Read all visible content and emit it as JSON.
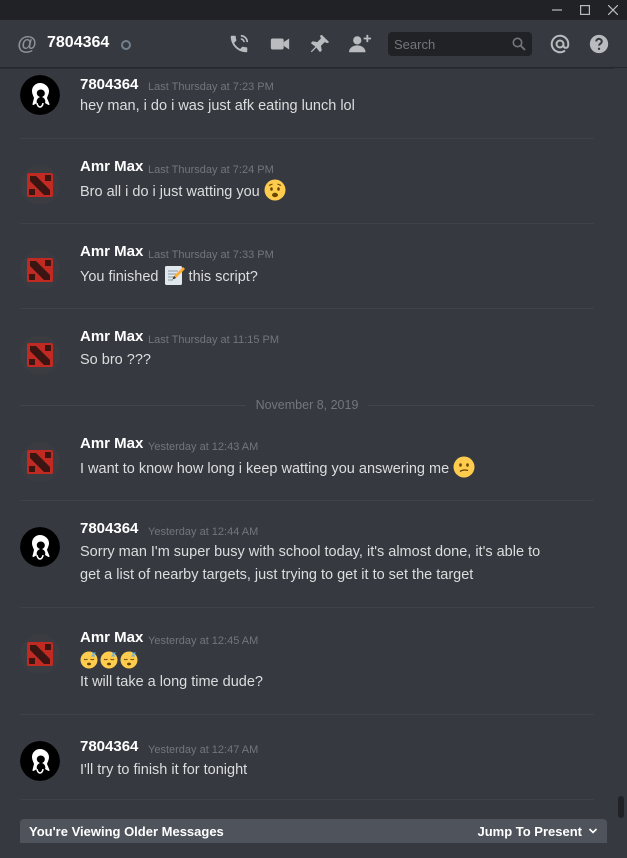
{
  "window": {
    "minimize": "—",
    "maximize": "☐",
    "close": "✕"
  },
  "header": {
    "channel_name": "7804364",
    "search_placeholder": "Search"
  },
  "messages": [
    {
      "author": "7804364",
      "timestamp": "Last Thursday at 7:23 PM",
      "lines": [
        "hey man, i do i was just afk eating lunch lol"
      ],
      "avatar": "ghost-avatar"
    },
    {
      "author": "Amr Max",
      "timestamp": "Last Thursday at 7:24 PM",
      "lines": [
        "Bro all i do i just watting you"
      ],
      "emoji_after": "worried-face",
      "avatar": "dota-avatar"
    },
    {
      "author": "Amr Max",
      "timestamp": "Last Thursday at 7:33 PM",
      "text_before": "You finished",
      "emoji_mid": "memo",
      "text_after": "this script?",
      "avatar": "dota-avatar"
    },
    {
      "author": "Amr Max",
      "timestamp": "Last Thursday at 11:15 PM",
      "lines": [
        "So bro ???"
      ],
      "avatar": "dota-avatar"
    },
    {
      "author": "Amr Max",
      "timestamp": "Yesterday at 12:43 AM",
      "lines": [
        "I want to know how long i keep watting you answering me"
      ],
      "emoji_after": "confused-face",
      "avatar": "dota-avatar"
    },
    {
      "author": "7804364",
      "timestamp": "Yesterday at 12:44 AM",
      "lines": [
        "Sorry man I'm super busy with school today, it's almost done, it's able to",
        "get a list of nearby targets, just trying to get it to set the target"
      ],
      "avatar": "ghost-avatar"
    },
    {
      "author": "Amr Max",
      "timestamp": "Yesterday at 12:45 AM",
      "lines": [
        "It will take a long time dude?"
      ],
      "emoji_row": [
        "sleeping-face",
        "sleeping-face",
        "sleeping-face"
      ],
      "avatar": "dota-avatar"
    },
    {
      "author": "7804364",
      "timestamp": "Yesterday at 12:47 AM",
      "lines": [
        "I'll try to finish it for tonight"
      ],
      "avatar": "ghost-avatar"
    }
  ],
  "date_separator": "November 8, 2019",
  "older_bar": {
    "label": "You're Viewing Older Messages",
    "jump_label": "Jump To Present"
  }
}
